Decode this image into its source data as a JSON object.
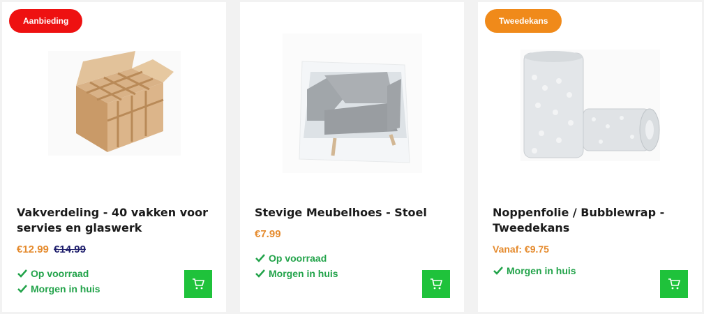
{
  "products": [
    {
      "badge": "Aanbieding",
      "badge_color": "#ee1111",
      "title": "Vakverdeling - 40 vakken voor servies en glaswerk",
      "price": "€12.99",
      "old_price": "€14.99",
      "stock": [
        "Op voorraad",
        "Morgen in huis"
      ],
      "image_icon": "cardboard-divider-box"
    },
    {
      "badge": "",
      "title": "Stevige Meubelhoes - Stoel",
      "price": "€7.99",
      "old_price": "",
      "stock": [
        "Op voorraad",
        "Morgen in huis"
      ],
      "image_icon": "chair-cover"
    },
    {
      "badge": "Tweedekans",
      "badge_color": "#f08a1a",
      "title": "Noppenfolie / Bubblewrap - Tweedekans",
      "price": "Vanaf: €9.75",
      "old_price": "",
      "stock": [
        "Morgen in huis"
      ],
      "image_icon": "bubblewrap-rolls"
    }
  ],
  "colors": {
    "price": "#e58b2e",
    "stock": "#22a34a",
    "cart": "#1fc23b"
  }
}
